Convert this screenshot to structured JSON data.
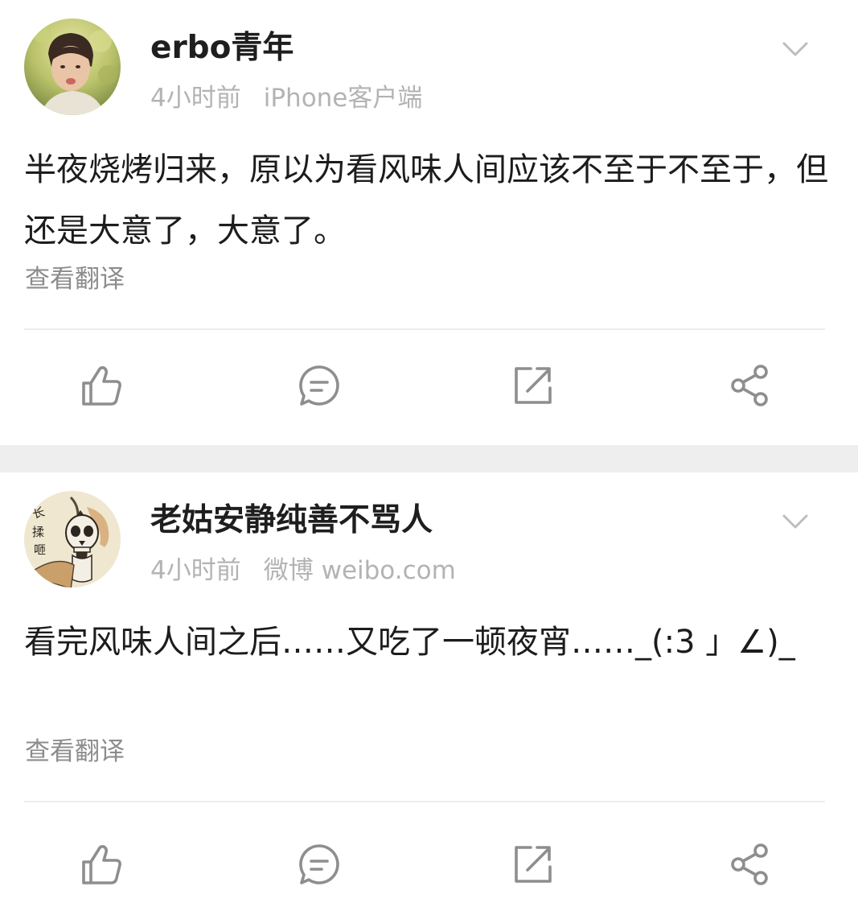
{
  "posts": [
    {
      "username": "erbo青年",
      "time": "4小时前",
      "source": "iPhone客户端",
      "content": "半夜烧烤归来，原以为看风味人间应该不至于不至于，但还是大意了，大意了。",
      "translate_label": "查看翻译",
      "avatar_icon": "portrait-photo-avatar",
      "actions": [
        "thumbs-up-icon",
        "comment-icon",
        "repost-icon",
        "share-icon"
      ]
    },
    {
      "username": "老姑安静纯善不骂人",
      "time": "4小时前",
      "source": "微博 weibo.com",
      "content": "看完风味人间之后……又吃了一顿夜宵……_(:3 」∠)_",
      "translate_label": "查看翻译",
      "avatar_icon": "skull-drawing-avatar",
      "actions": [
        "thumbs-up-icon",
        "comment-icon",
        "repost-icon",
        "share-icon"
      ]
    }
  ],
  "colors": {
    "text": "#1c1c1c",
    "meta": "#b3b3b3",
    "translate": "#8c8c8c",
    "icon": "#8e8e8e",
    "separator": "#eeeeee",
    "divider": "#ececec"
  }
}
